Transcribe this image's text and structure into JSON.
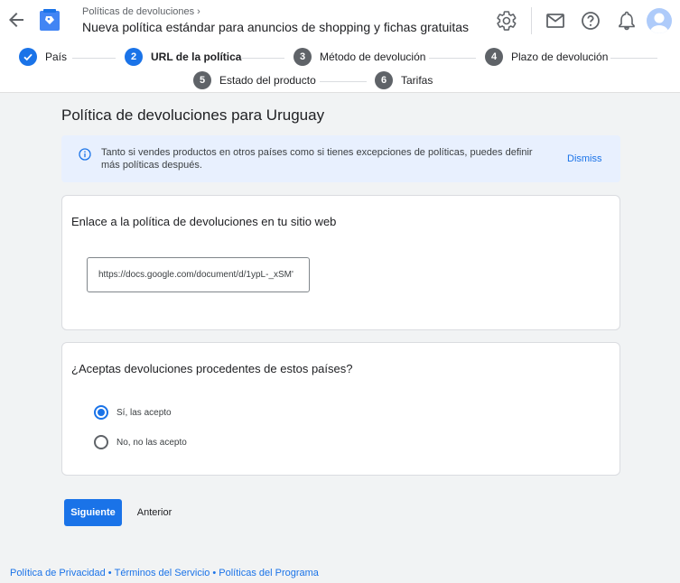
{
  "header": {
    "breadcrumb": "Políticas de devoluciones",
    "page_title": "Nueva política estándar para anuncios de shopping y fichas gratuitas",
    "icons": [
      "back-arrow-icon",
      "settings-icon",
      "mail-icon",
      "help-icon",
      "notifications-icon"
    ]
  },
  "stepper": {
    "steps": [
      {
        "number": "",
        "label": "País",
        "state": "done"
      },
      {
        "number": "2",
        "label": "URL de la política",
        "state": "active"
      },
      {
        "number": "3",
        "label": "Método de devolución",
        "state": "pending"
      },
      {
        "number": "4",
        "label": "Plazo de devolución",
        "state": "pending"
      },
      {
        "number": "5",
        "label": "Estado del producto",
        "state": "pending"
      },
      {
        "number": "6",
        "label": "Tarifas",
        "state": "pending"
      }
    ]
  },
  "main": {
    "title": "Política de devoluciones para Uruguay",
    "info_banner": {
      "text": "Tanto si vendes productos en otros países como si tienes excepciones de políticas, puedes definir más políticas después.",
      "dismiss_label": "Dismiss"
    },
    "url_card": {
      "title": "Enlace a la política de devoluciones en tu sitio web",
      "url_value": "https://docs.google.com/document/d/1ypL-_xSM'"
    },
    "returns_card": {
      "title": "¿Aceptas devoluciones procedentes de estos países?",
      "options": [
        {
          "label": "Sí, las acepto",
          "selected": true
        },
        {
          "label": "No, no las acepto",
          "selected": false
        }
      ]
    },
    "buttons": {
      "next_label": "Siguiente",
      "back_label": "Anterior"
    }
  },
  "footer": {
    "links": [
      "Política de Privacidad",
      "Términos del Servicio",
      "Políticas del Programa"
    ],
    "separator": "•"
  },
  "colors": {
    "accent": "#1a73e8",
    "banner_bg": "#e8f0fe",
    "page_bg": "#f1f3f4"
  }
}
